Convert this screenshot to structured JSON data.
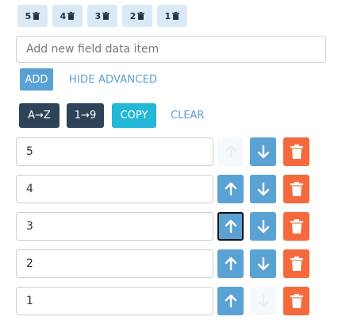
{
  "chips": [
    {
      "label": "5"
    },
    {
      "label": "4"
    },
    {
      "label": "3"
    },
    {
      "label": "2"
    },
    {
      "label": "1"
    }
  ],
  "new_item": {
    "placeholder": "Add new field data item",
    "value": ""
  },
  "actions": {
    "add_label": "ADD",
    "hide_advanced_label": "HIDE ADVANCED",
    "sort_az_label": "A→Z",
    "sort_19_label": "1→9",
    "copy_label": "COPY",
    "clear_label": "CLEAR"
  },
  "items": [
    {
      "value": "5"
    },
    {
      "value": "4"
    },
    {
      "value": "3"
    },
    {
      "value": "2"
    },
    {
      "value": "1"
    }
  ],
  "colors": {
    "primary": "#5ba2d4",
    "dark": "#2e4358",
    "copy": "#22b8d6",
    "danger": "#f46a3c",
    "chip_bg": "#dbe9f6"
  }
}
